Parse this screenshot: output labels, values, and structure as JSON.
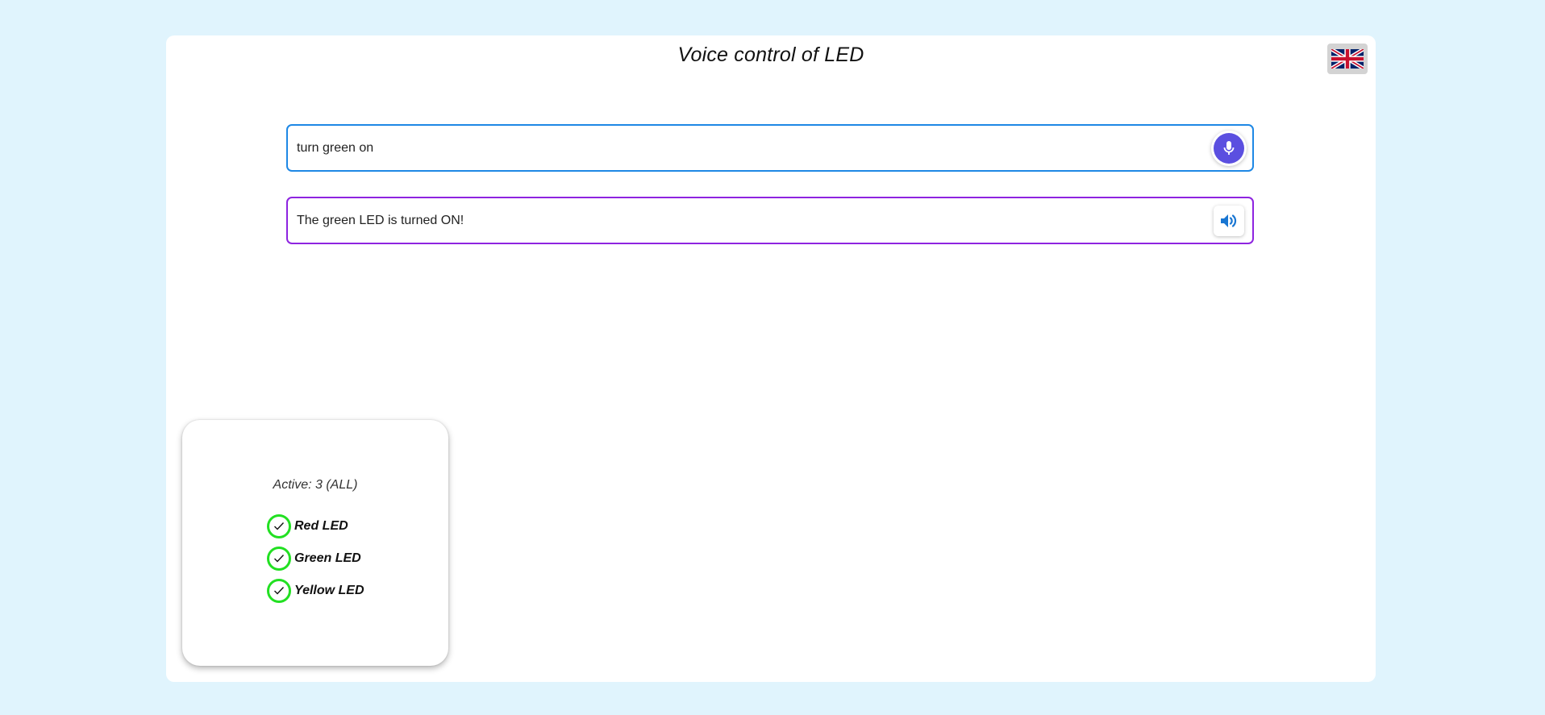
{
  "app": {
    "title": "Voice control of LED",
    "language_flag": "uk-flag-icon"
  },
  "input": {
    "value": "turn green on",
    "mic_icon": "microphone-icon"
  },
  "output": {
    "value": "The green LED is turned ON!",
    "speaker_icon": "speaker-icon"
  },
  "status": {
    "active_text": "Active: 3 (ALL)",
    "leds": [
      {
        "label": "Red LED",
        "on": true
      },
      {
        "label": "Green LED",
        "on": true
      },
      {
        "label": "Yellow LED",
        "on": true
      }
    ]
  },
  "colors": {
    "background": "#e0f4fd",
    "input_border": "#1e88e5",
    "output_border": "#8e24e0",
    "mic_button": "#5b4fe0",
    "speaker_icon": "#1976d2",
    "check_ring": "#22e022"
  }
}
